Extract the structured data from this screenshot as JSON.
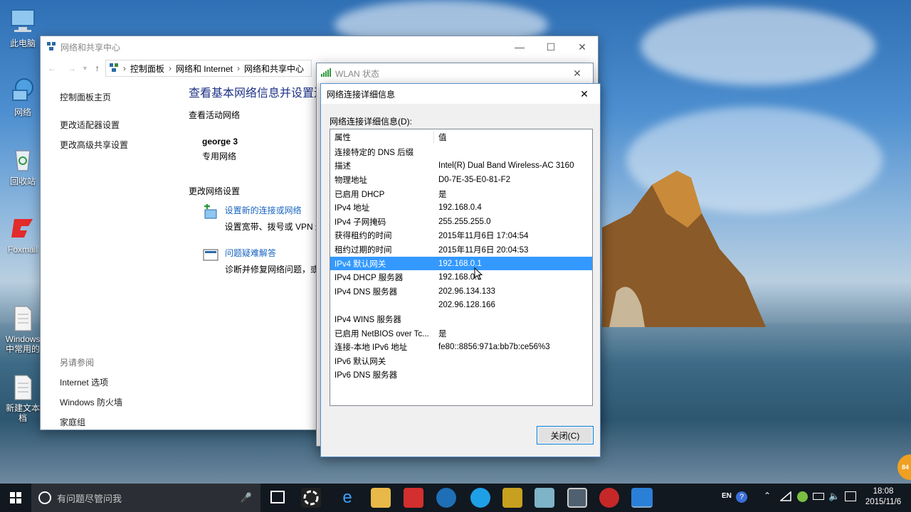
{
  "desktop": {
    "icons": [
      {
        "label": "此电脑",
        "icon": "computer-icon"
      },
      {
        "label": "网络",
        "icon": "network-icon"
      },
      {
        "label": "回收站",
        "icon": "recycle-bin-icon"
      },
      {
        "label": "Foxmail",
        "icon": "foxmail-icon"
      },
      {
        "label": "Windows\n中常用的",
        "icon": "document-icon"
      },
      {
        "label": "新建文本\n档",
        "icon": "text-file-icon"
      }
    ]
  },
  "network_center": {
    "title": "网络和共享中心",
    "breadcrumb": [
      "控制面板",
      "网络和 Internet",
      "网络和共享中心"
    ],
    "left_nav": [
      "控制面板主页",
      "更改适配器设置",
      "更改高级共享设置"
    ],
    "see_also_title": "另请参阅",
    "see_also": [
      "Internet 选项",
      "Windows 防火墙",
      "家庭组"
    ],
    "heading": "查看基本网络信息并设置连",
    "active_label": "查看活动网络",
    "network_name": "george  3",
    "network_type": "专用网络",
    "change_label": "更改网络设置",
    "tasks": [
      {
        "title": "设置新的连接或网络",
        "desc": "设置宽带、拨号或 VPN 连"
      },
      {
        "title": "问题疑难解答",
        "desc": "诊断并修复网络问题，或"
      }
    ]
  },
  "wlan_status": {
    "title": "WLAN 状态"
  },
  "details": {
    "title": "网络连接详细信息",
    "list_label": "网络连接详细信息(D):",
    "col_property": "属性",
    "col_value": "值",
    "rows": [
      {
        "k": "连接特定的 DNS 后缀",
        "v": ""
      },
      {
        "k": "描述",
        "v": "Intel(R) Dual Band Wireless-AC 3160"
      },
      {
        "k": "物理地址",
        "v": "D0-7E-35-E0-81-F2"
      },
      {
        "k": "已启用 DHCP",
        "v": "是"
      },
      {
        "k": "IPv4 地址",
        "v": "192.168.0.4"
      },
      {
        "k": "IPv4 子网掩码",
        "v": "255.255.255.0"
      },
      {
        "k": "获得租约的时间",
        "v": "2015年11月6日 17:04:54"
      },
      {
        "k": "租约过期的时间",
        "v": "2015年11月6日 20:04:53"
      },
      {
        "k": "IPv4 默认网关",
        "v": "192.168.0.1",
        "selected": true
      },
      {
        "k": "IPv4 DHCP 服务器",
        "v": "192.168.0.1"
      },
      {
        "k": "IPv4 DNS 服务器",
        "v": "202.96.134.133"
      },
      {
        "k": "",
        "v": "202.96.128.166"
      },
      {
        "k": "IPv4 WINS 服务器",
        "v": ""
      },
      {
        "k": "已启用 NetBIOS over Tc...",
        "v": "是"
      },
      {
        "k": "连接-本地 IPv6 地址",
        "v": "fe80::8856:971a:bb7b:ce56%3"
      },
      {
        "k": "IPv6 默认网关",
        "v": ""
      },
      {
        "k": "IPv6 DNS 服务器",
        "v": ""
      }
    ],
    "close_label": "关闭(C)"
  },
  "taskbar": {
    "search_placeholder": "有问题尽管问我",
    "lang": "EN",
    "time": "18:08",
    "date": "2015/11/6",
    "badge": "84"
  }
}
